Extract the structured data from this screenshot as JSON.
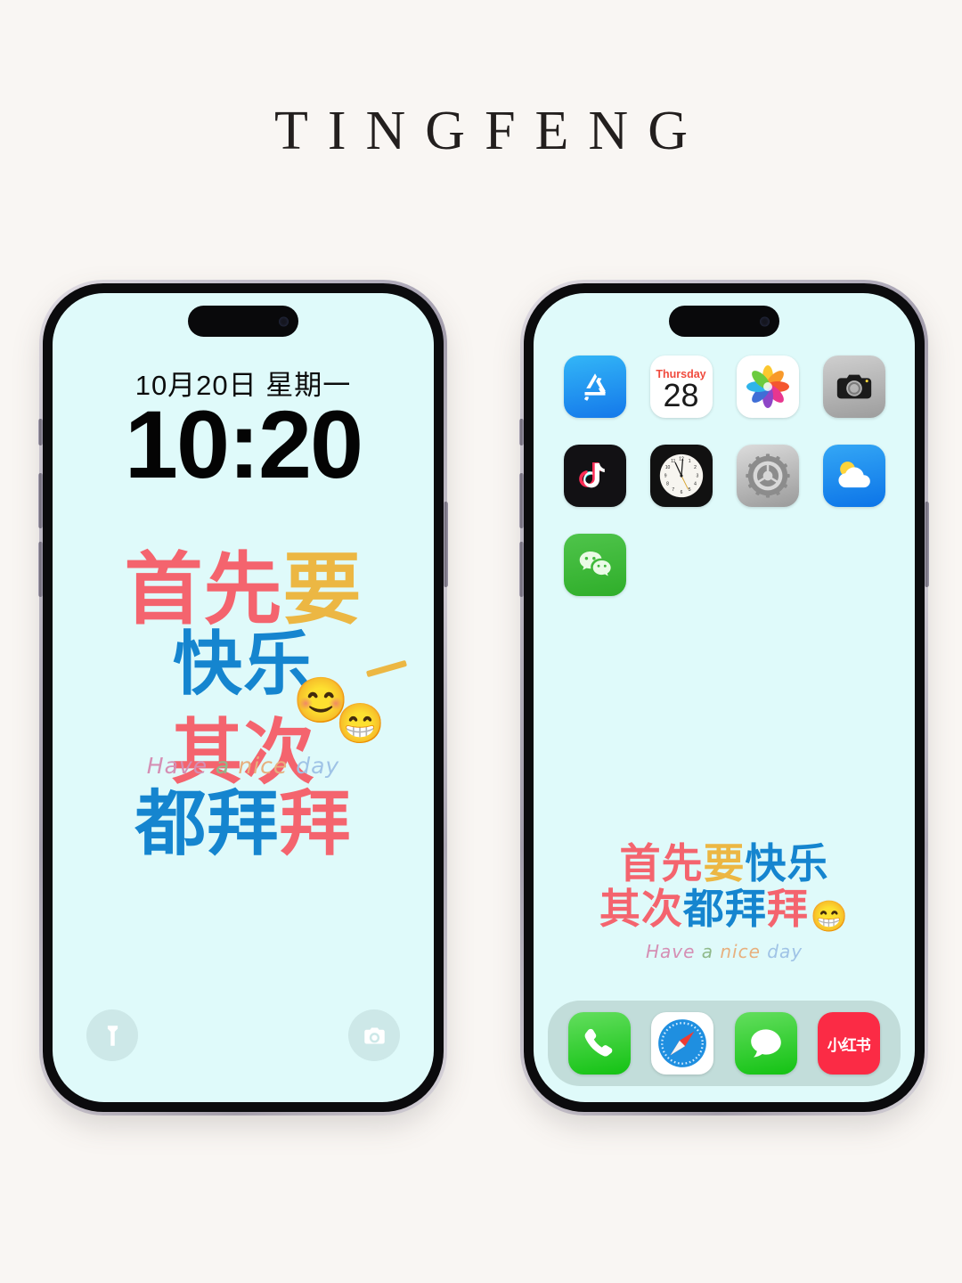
{
  "page": {
    "background_color": "#f9f6f3",
    "brand_title": "TINGFENG"
  },
  "lock_screen": {
    "wallpaper_color": "#dffafa",
    "date": "10月20日 星期一",
    "time": "10:20",
    "wallpaper_text": {
      "line1_a": "首先",
      "line1_b": "要",
      "line2": "快乐",
      "line3": "其次",
      "line4_a": "都拜",
      "line4_b": "拜",
      "tagline": {
        "have": "Have",
        "a": "a",
        "nice": "nice",
        "day": "day"
      },
      "emoji_1": "😊",
      "emoji_2": "😁"
    },
    "quick_actions": {
      "flashlight": "flashlight",
      "camera": "camera"
    },
    "colors": {
      "pink": "#f4646e",
      "blue": "#1585cf",
      "gold": "#ecb743"
    }
  },
  "home_screen": {
    "wallpaper_color": "#dffafa",
    "apps": [
      {
        "name": "App Store",
        "icon": "appstore-icon"
      },
      {
        "name": "Calendar",
        "icon": "calendar-icon",
        "weekday": "Thursday",
        "day": "28"
      },
      {
        "name": "Photos",
        "icon": "photos-icon"
      },
      {
        "name": "Camera",
        "icon": "camera-icon"
      },
      {
        "name": "TikTok",
        "icon": "tiktok-icon"
      },
      {
        "name": "Clock",
        "icon": "clock-icon"
      },
      {
        "name": "Settings",
        "icon": "settings-icon"
      },
      {
        "name": "Weather",
        "icon": "weather-icon"
      },
      {
        "name": "WeChat",
        "icon": "wechat-icon"
      }
    ],
    "dock": [
      {
        "name": "Phone",
        "icon": "phone-icon"
      },
      {
        "name": "Safari",
        "icon": "safari-icon"
      },
      {
        "name": "Messages",
        "icon": "messages-icon"
      },
      {
        "name": "小红书",
        "icon": "xiaohongshu-icon",
        "label": "小红书"
      }
    ],
    "wallpaper_text": {
      "line1_a": "首先",
      "line1_b": "要",
      "line1_c": "快乐",
      "line2_a": "其次",
      "line2_b": "都拜",
      "line2_c": "拜",
      "emoji": "😁",
      "tagline": {
        "have": "Have",
        "a": "a",
        "nice": "nice",
        "day": "day"
      }
    }
  }
}
